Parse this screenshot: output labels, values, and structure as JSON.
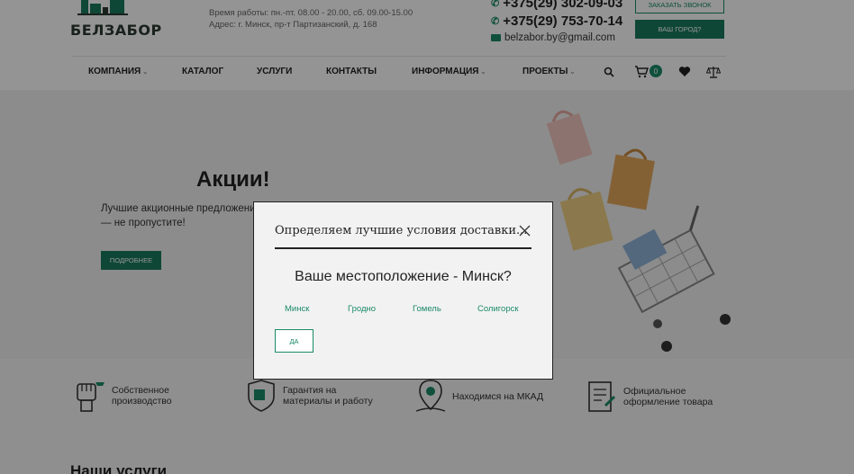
{
  "header": {
    "logo_text": "БЕЛЗАБОР",
    "hours": "Время работы: пн.-пт. 08.00 - 20.00, сб. 09.00-15.00",
    "address": "Адрес: г. Минск, пр-т Партизанский, д. 168",
    "phones": [
      "+375(29) 302-09-03",
      "+375(29) 753-70-14"
    ],
    "email": "belzabor.by@gmail.com",
    "callback_label": "ЗАКАЗАТЬ ЗВОНОК",
    "city_label": "ВАШ ГОРОД?"
  },
  "nav": {
    "items": [
      {
        "label": "КОМПАНИЯ",
        "has_caret": true
      },
      {
        "label": "КАТАЛОГ",
        "has_caret": false
      },
      {
        "label": "УСЛУГИ",
        "has_caret": false
      },
      {
        "label": "КОНТАКТЫ",
        "has_caret": false
      },
      {
        "label": "ИНФОРМАЦИЯ",
        "has_caret": true
      },
      {
        "label": "ПРОЕКТЫ",
        "has_caret": true
      }
    ],
    "cart_count": "0"
  },
  "banner": {
    "title": "Акции!",
    "subtitle": "Лучшие акционные предложения — не пропустите!",
    "button_label": "ПОДРОБНЕЕ"
  },
  "features": [
    {
      "icon": "fist-icon",
      "text": "Собственное производство"
    },
    {
      "icon": "shield-icon",
      "text": "Гарантия на материалы и работу"
    },
    {
      "icon": "map-pin-icon",
      "text": "Находимся на МКАД"
    },
    {
      "icon": "document-icon",
      "text": "Официальное оформление товара"
    }
  ],
  "services_title": "Наши услуги",
  "modal": {
    "title": "Определяем лучшие условия доставки...",
    "question": "Ваше местоположение - Минск?",
    "cities": [
      "Минск",
      "Гродно",
      "Гомель",
      "Солигорск"
    ],
    "yes_label": "ДА"
  },
  "colors": {
    "accent": "#1a8a68",
    "accent_dark": "#1a7a5e"
  }
}
